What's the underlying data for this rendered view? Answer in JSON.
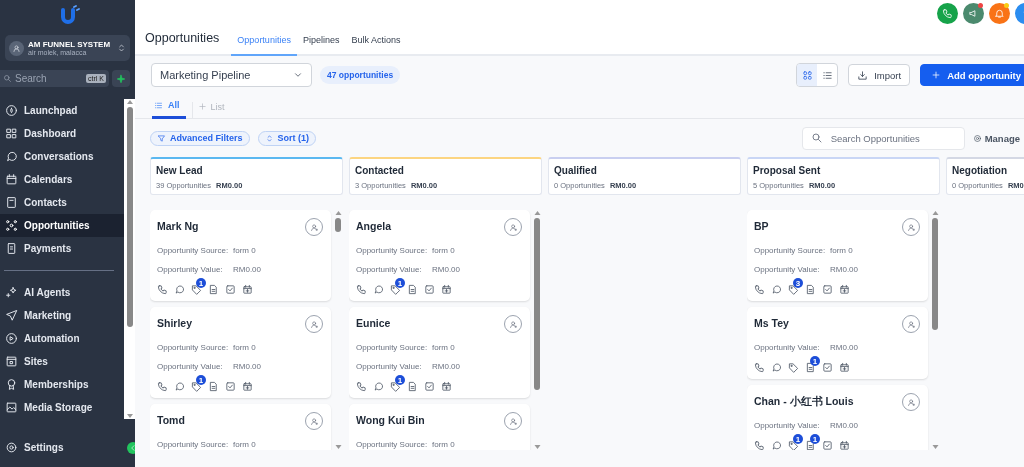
{
  "sidebar": {
    "account": {
      "name": "AM FUNNEL SYSTEM",
      "location": "air molek, malacca"
    },
    "search": {
      "placeholder": "Search",
      "shortcut": "ctrl K"
    },
    "groups": [
      {
        "items": [
          {
            "label": "Launchpad",
            "selected": false
          },
          {
            "label": "Dashboard",
            "selected": false
          },
          {
            "label": "Conversations",
            "selected": false
          },
          {
            "label": "Calendars",
            "selected": false
          },
          {
            "label": "Contacts",
            "selected": false
          },
          {
            "label": "Opportunities",
            "selected": true
          },
          {
            "label": "Payments",
            "selected": false
          }
        ]
      },
      {
        "items": [
          {
            "label": "AI Agents",
            "selected": false
          },
          {
            "label": "Marketing",
            "selected": false
          },
          {
            "label": "Automation",
            "selected": false
          },
          {
            "label": "Sites",
            "selected": false
          },
          {
            "label": "Memberships",
            "selected": false
          },
          {
            "label": "Media Storage",
            "selected": false
          }
        ]
      }
    ],
    "footer_item": {
      "label": "Settings"
    }
  },
  "header": {
    "title": "Opportunities",
    "tabs": [
      {
        "label": "Opportunities",
        "selected": true
      },
      {
        "label": "Pipelines",
        "selected": false
      },
      {
        "label": "Bulk Actions",
        "selected": false
      }
    ]
  },
  "toolbar": {
    "pipeline": "Marketing Pipeline",
    "count": "47 opportunities",
    "view_modes": [
      {
        "selected": true
      },
      {
        "selected": false
      }
    ],
    "import_button": "Import",
    "add_button": "Add opportunity"
  },
  "views": {
    "tabs": [
      {
        "label": "All",
        "selected": true
      }
    ],
    "add_list": "List"
  },
  "filters": {
    "advanced": "Advanced Filters",
    "sort": "Sort (1)",
    "search_placeholder": "Search Opportunities",
    "manage": "Manage"
  },
  "columns": [
    {
      "name": "New Lead",
      "count": "39 Opportunities",
      "value": "RM0.00",
      "color": "#5bb8f0",
      "cards": [
        {
          "name": "Mark Ng",
          "fields": [
            {
              "label": "Opportunity Source:",
              "value": "form 0"
            },
            {
              "label": "Opportunity Value:",
              "value": "RM0.00"
            }
          ],
          "tag_badge": "1"
        },
        {
          "name": "Shirley",
          "fields": [
            {
              "label": "Opportunity Source:",
              "value": "form 0"
            },
            {
              "label": "Opportunity Value:",
              "value": "RM0.00"
            }
          ],
          "tag_badge": "1"
        },
        {
          "name": "Tomd",
          "fields": [
            {
              "label": "Opportunity Source:",
              "value": "form 0"
            }
          ]
        }
      ]
    },
    {
      "name": "Contacted",
      "count": "3 Opportunities",
      "value": "RM0.00",
      "color": "#fcd581",
      "cards": [
        {
          "name": "Angela",
          "fields": [
            {
              "label": "Opportunity Source:",
              "value": "form 0"
            },
            {
              "label": "Opportunity Value:",
              "value": "RM0.00"
            }
          ],
          "tag_badge": "1"
        },
        {
          "name": "Eunice",
          "fields": [
            {
              "label": "Opportunity Source:",
              "value": "form 0"
            },
            {
              "label": "Opportunity Value:",
              "value": "RM0.00"
            }
          ],
          "tag_badge": "1"
        },
        {
          "name": "Wong Kui Bin",
          "fields": [
            {
              "label": "Opportunity Source:",
              "value": "form 0"
            }
          ]
        }
      ]
    },
    {
      "name": "Qualified",
      "count": "0 Opportunities",
      "value": "RM0.00",
      "color": "#c9cff0"
    },
    {
      "name": "Proposal Sent",
      "count": "5 Opportunities",
      "value": "RM0.00",
      "color": "#c9d6f5",
      "cards": [
        {
          "name": "BP",
          "fields": [
            {
              "label": "Opportunity Source:",
              "value": "form 0"
            },
            {
              "label": "Opportunity Value:",
              "value": "RM0.00"
            }
          ],
          "tag_badge": "3"
        },
        {
          "name": "Ms Tey",
          "fields": [
            {
              "label": "Opportunity Value:",
              "value": "RM0.00"
            }
          ],
          "note_badge": "1"
        },
        {
          "name": "Chan - 小红书 Louis",
          "fields": [
            {
              "label": "Opportunity Value:",
              "value": "RM0.00"
            }
          ],
          "tag_badge": "1",
          "note_badge": "1"
        }
      ]
    },
    {
      "name": "Negotiation",
      "count": "0 Opportunities",
      "value": "RM0",
      "color": "#d4d8e4"
    }
  ]
}
